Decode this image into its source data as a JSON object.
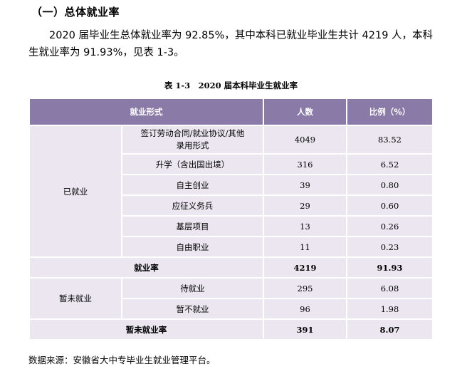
{
  "section_title": "（一）总体就业率",
  "paragraph": "2020 届毕业生总体就业率为 92.85%，其中本科已就业毕业生共计 4219 人，本科生就业率为 91.93%，见表 1-3。",
  "table": {
    "caption": "表 1-3　2020 届本科毕业生就业率",
    "headers": [
      "就业形式",
      "人数",
      "比例（%）"
    ],
    "employed_group": "已就业",
    "employed_rows": [
      {
        "form": "签订劳动合同/就业协议/其他录用形式",
        "count": "4049",
        "pct": "83.52"
      },
      {
        "form": "升学（含出国出境）",
        "count": "316",
        "pct": "6.52"
      },
      {
        "form": "自主创业",
        "count": "39",
        "pct": "0.80"
      },
      {
        "form": "应征义务兵",
        "count": "29",
        "pct": "0.60"
      },
      {
        "form": "基层项目",
        "count": "13",
        "pct": "0.26"
      },
      {
        "form": "自由职业",
        "count": "11",
        "pct": "0.23"
      }
    ],
    "employment_rate": {
      "label": "就业率",
      "count": "4219",
      "pct": "91.93"
    },
    "unemployed_group": "暂未就业",
    "unemployed_rows": [
      {
        "form": "待就业",
        "count": "295",
        "pct": "6.08"
      },
      {
        "form": "暂不就业",
        "count": "96",
        "pct": "1.98"
      }
    ],
    "unemployment_rate": {
      "label": "暂未就业率",
      "count": "391",
      "pct": "8.07"
    }
  },
  "source": "数据来源：安徽省大中专毕业生就业管理平台。"
}
